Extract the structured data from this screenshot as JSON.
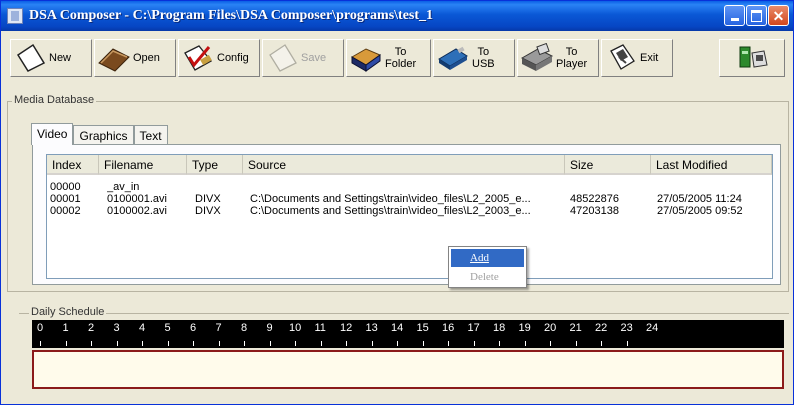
{
  "window": {
    "title": "DSA Composer - C:\\Program Files\\DSA Composer\\programs\\test_1"
  },
  "toolbar": {
    "buttons": [
      {
        "label": "New",
        "icon": "new-document-icon",
        "enabled": true
      },
      {
        "label": "Open",
        "icon": "open-book-icon",
        "enabled": true
      },
      {
        "label": "Config",
        "icon": "checklist-icon",
        "enabled": true
      },
      {
        "label": "Save",
        "icon": "save-icon",
        "enabled": false
      },
      {
        "label": "To\nFolder",
        "icon": "folder-icon",
        "enabled": true
      },
      {
        "label": "To\nUSB",
        "icon": "usb-drive-icon",
        "enabled": true
      },
      {
        "label": "To\nPlayer",
        "icon": "player-icon",
        "enabled": true
      },
      {
        "label": "Exit",
        "icon": "exit-door-icon",
        "enabled": true
      }
    ],
    "extra_icon": "network-computer-icon"
  },
  "media_database": {
    "title": "Media Database",
    "tabs": [
      {
        "label": "Video",
        "active": true
      },
      {
        "label": "Graphics",
        "active": false
      },
      {
        "label": "Text",
        "active": false
      }
    ],
    "columns": [
      "Index",
      "Filename",
      "Type",
      "Source",
      "Size",
      "Last Modified"
    ],
    "rows": [
      {
        "index": "00000",
        "filename": "_av_in",
        "type": "",
        "source": "",
        "size": "",
        "modified": ""
      },
      {
        "index": "00001",
        "filename": "0100001.avi",
        "type": "DIVX",
        "source": "C:\\Documents and Settings\\train\\video_files\\L2_2005_e...",
        "size": "48522876",
        "modified": "27/05/2005 11:24"
      },
      {
        "index": "00002",
        "filename": "0100002.avi",
        "type": "DIVX",
        "source": "C:\\Documents and Settings\\train\\video_files\\L2_2003_e...",
        "size": "47203138",
        "modified": "27/05/2005 09:52"
      }
    ]
  },
  "context_menu": {
    "items": [
      {
        "label": "Add",
        "highlighted": true,
        "enabled": true
      },
      {
        "label": "Delete",
        "highlighted": false,
        "enabled": false
      }
    ]
  },
  "daily_schedule": {
    "title": "Daily Schedule",
    "hours": [
      "0",
      "1",
      "2",
      "3",
      "4",
      "5",
      "6",
      "7",
      "8",
      "9",
      "10",
      "11",
      "12",
      "13",
      "14",
      "15",
      "16",
      "17",
      "18",
      "19",
      "20",
      "21",
      "22",
      "23",
      "24"
    ]
  },
  "colors": {
    "title_bar": "#0a58d6",
    "timeline_bg": "#000000",
    "schedule_border": "#8b1a1a",
    "schedule_fill": "#fffbeb",
    "menu_highlight": "#316ac5"
  }
}
